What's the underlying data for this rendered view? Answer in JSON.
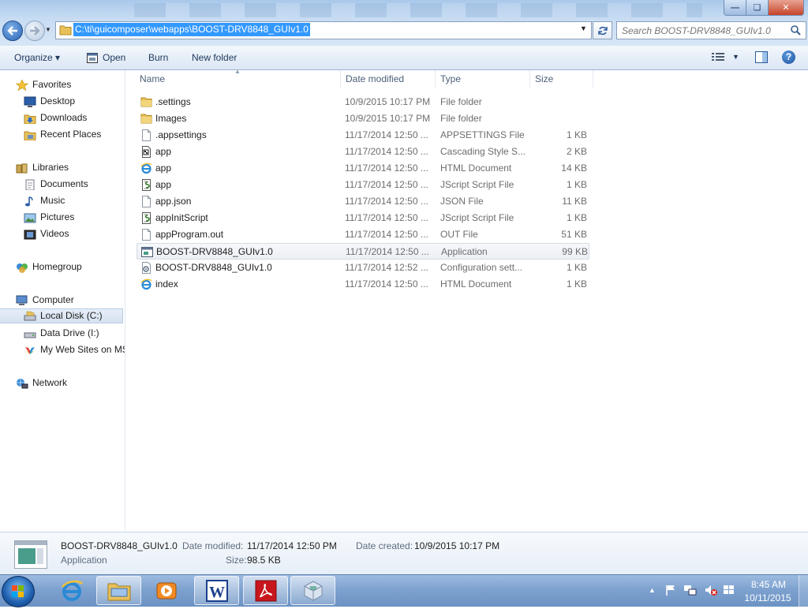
{
  "address": {
    "path": "C:\\ti\\guicomposer\\webapps\\BOOST-DRV8848_GUIv1.0"
  },
  "search": {
    "placeholder": "Search BOOST-DRV8848_GUIv1.0"
  },
  "toolbar": {
    "organize": "Organize ▾",
    "open": "Open",
    "burn": "Burn",
    "new_folder": "New folder"
  },
  "nav": {
    "favorites": "Favorites",
    "desktop": "Desktop",
    "downloads": "Downloads",
    "recent_places": "Recent Places",
    "libraries": "Libraries",
    "documents": "Documents",
    "music": "Music",
    "pictures": "Pictures",
    "videos": "Videos",
    "homegroup": "Homegroup",
    "computer": "Computer",
    "local_disk": "Local Disk (C:)",
    "data_drive": "Data Drive (I:)",
    "web_sites": "My Web Sites on MSN",
    "network": "Network"
  },
  "columns": {
    "name": "Name",
    "date": "Date modified",
    "type": "Type",
    "size": "Size"
  },
  "files": [
    {
      "name": ".settings",
      "date": "10/9/2015 10:17 PM",
      "type": "File folder",
      "size": "",
      "icon": "folder-icon"
    },
    {
      "name": "Images",
      "date": "10/9/2015 10:17 PM",
      "type": "File folder",
      "size": "",
      "icon": "folder-icon"
    },
    {
      "name": ".appsettings",
      "date": "11/17/2014 12:50 ...",
      "type": "APPSETTINGS File",
      "size": "1 KB",
      "icon": "blank-file-icon"
    },
    {
      "name": "app",
      "date": "11/17/2014 12:50 ...",
      "type": "Cascading Style S...",
      "size": "2 KB",
      "icon": "css-file-icon"
    },
    {
      "name": "app",
      "date": "11/17/2014 12:50 ...",
      "type": "HTML Document",
      "size": "14 KB",
      "icon": "ie-file-icon"
    },
    {
      "name": "app",
      "date": "11/17/2014 12:50 ...",
      "type": "JScript Script File",
      "size": "1 KB",
      "icon": "script-file-icon"
    },
    {
      "name": "app.json",
      "date": "11/17/2014 12:50 ...",
      "type": "JSON File",
      "size": "11 KB",
      "icon": "blank-file-icon"
    },
    {
      "name": "appInitScript",
      "date": "11/17/2014 12:50 ...",
      "type": "JScript Script File",
      "size": "1 KB",
      "icon": "script-file-icon"
    },
    {
      "name": "appProgram.out",
      "date": "11/17/2014 12:50 ...",
      "type": "OUT File",
      "size": "51 KB",
      "icon": "blank-file-icon"
    },
    {
      "name": "BOOST-DRV8848_GUIv1.0",
      "date": "11/17/2014 12:50 ...",
      "type": "Application",
      "size": "99 KB",
      "icon": "application-icon",
      "selected": true
    },
    {
      "name": "BOOST-DRV8848_GUIv1.0",
      "date": "11/17/2014 12:52 ...",
      "type": "Configuration sett...",
      "size": "1 KB",
      "icon": "config-file-icon"
    },
    {
      "name": "index",
      "date": "11/17/2014 12:50 ...",
      "type": "HTML Document",
      "size": "1 KB",
      "icon": "ie-file-icon"
    }
  ],
  "details": {
    "name": "BOOST-DRV8848_GUIv1.0",
    "kind": "Application",
    "modified_label": "Date modified:",
    "modified": "11/17/2014 12:50 PM",
    "created_label": "Date created:",
    "created": "10/9/2015 10:17 PM",
    "size_label": "Size:",
    "size": "98.5 KB"
  },
  "clock": {
    "time": "8:45 AM",
    "date": "10/11/2015"
  },
  "colors": {
    "selection": "#3399ff",
    "toolbar_text": "#1e395b",
    "meta_text": "#6d6d6d"
  }
}
